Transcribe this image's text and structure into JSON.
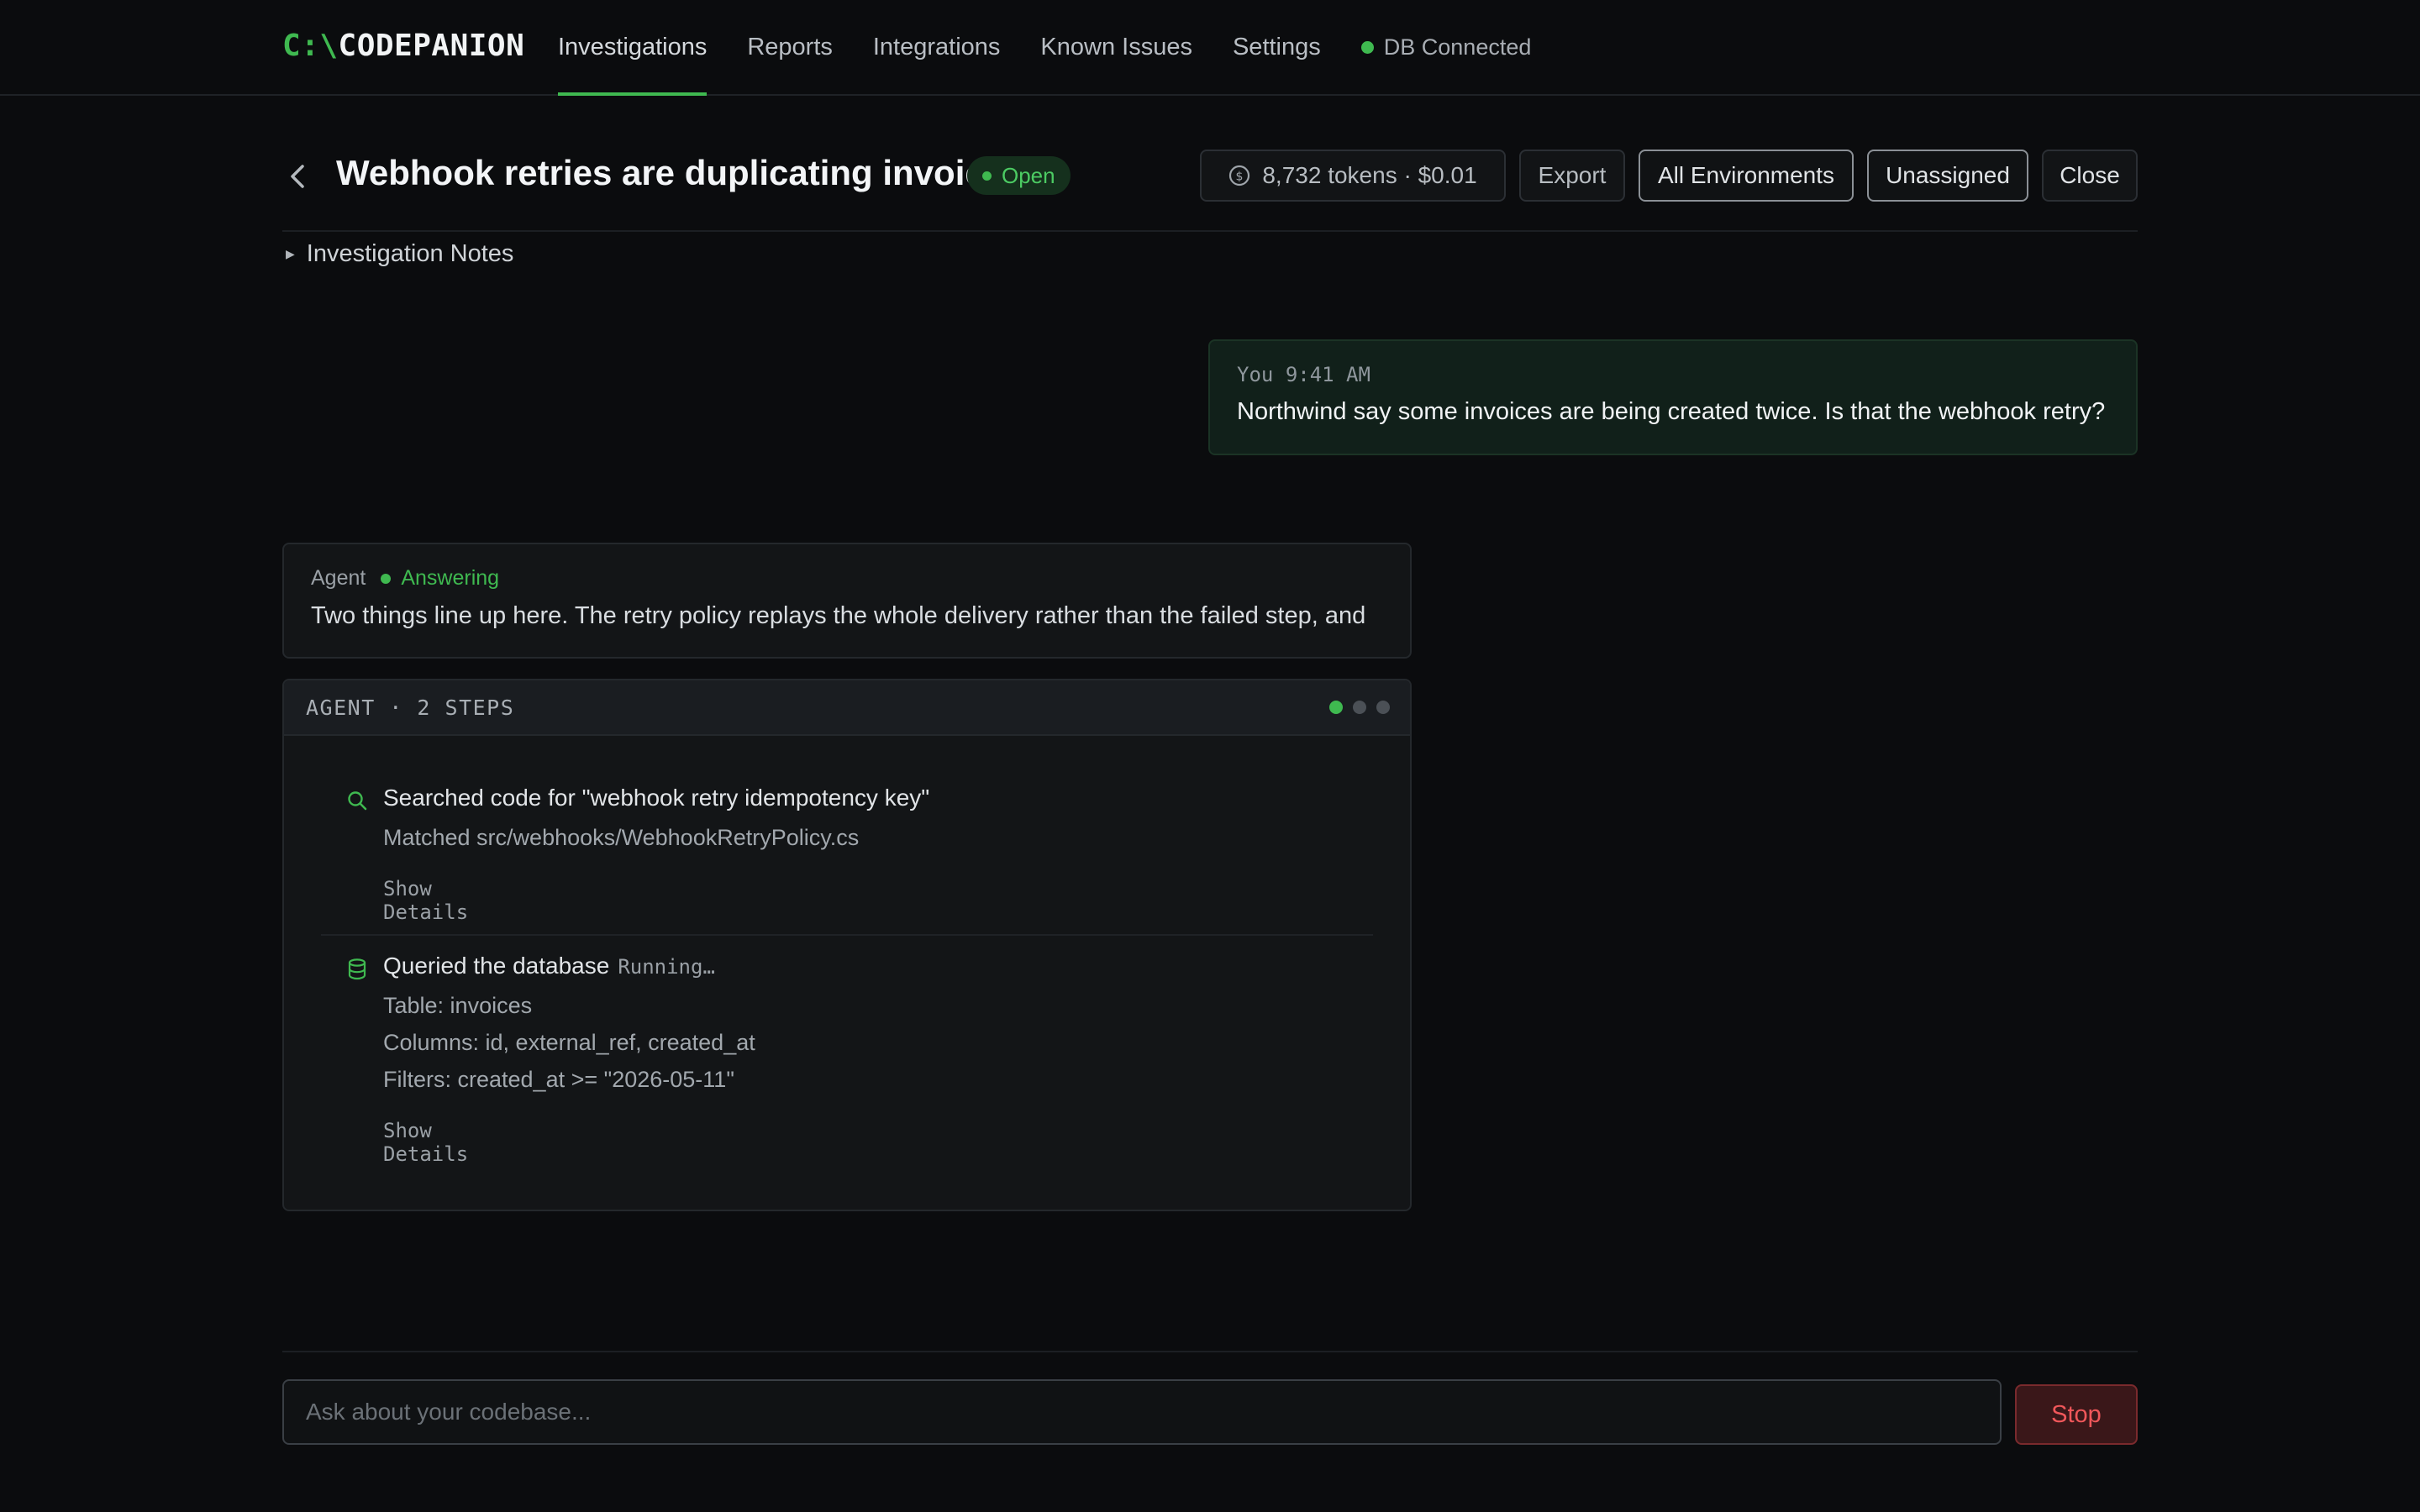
{
  "app": {
    "logo_prefix": "C:\\",
    "logo_name": "CODEPANION"
  },
  "nav": {
    "items": [
      {
        "label": "Investigations",
        "active": true
      },
      {
        "label": "Reports",
        "active": false
      },
      {
        "label": "Integrations",
        "active": false
      },
      {
        "label": "Known Issues",
        "active": false
      },
      {
        "label": "Settings",
        "active": false
      }
    ],
    "db_status": "DB Connected"
  },
  "investigation": {
    "title": "Webhook retries are duplicating invoices",
    "status": "Open",
    "tokens": "8,732 tokens · $0.01",
    "export_label": "Export",
    "environment_label": "All Environments",
    "assignee_label": "Unassigned",
    "close_label": "Close",
    "notes_label": "Investigation Notes"
  },
  "messages": {
    "user": {
      "author": "You",
      "time": "9:41 AM",
      "text": "Northwind say some invoices are being created twice. Is that the webhook retry?"
    },
    "agent": {
      "author": "Agent",
      "status": "Answering",
      "text": "Two things line up here. The retry policy replays the whole delivery rather than the failed step, and"
    }
  },
  "steps": {
    "header": "AGENT · 2 STEPS",
    "items": [
      {
        "icon": "search-icon",
        "title": "Searched code for \"webhook retry idempotency key\"",
        "running": "",
        "lines": [
          "Matched src/webhooks/WebhookRetryPolicy.cs"
        ],
        "details_label": "Show Details"
      },
      {
        "icon": "database-icon",
        "title": "Queried the database",
        "running": "Running…",
        "lines": [
          "Table: invoices",
          "Columns: id, external_ref, created_at",
          "Filters: created_at >= \"2026-05-11\""
        ],
        "details_label": "Show Details"
      }
    ]
  },
  "composer": {
    "placeholder": "Ask about your codebase...",
    "stop_label": "Stop"
  },
  "colors": {
    "accent": "#3fb950",
    "background": "#0b0c0e",
    "stop": "#f0575a"
  }
}
